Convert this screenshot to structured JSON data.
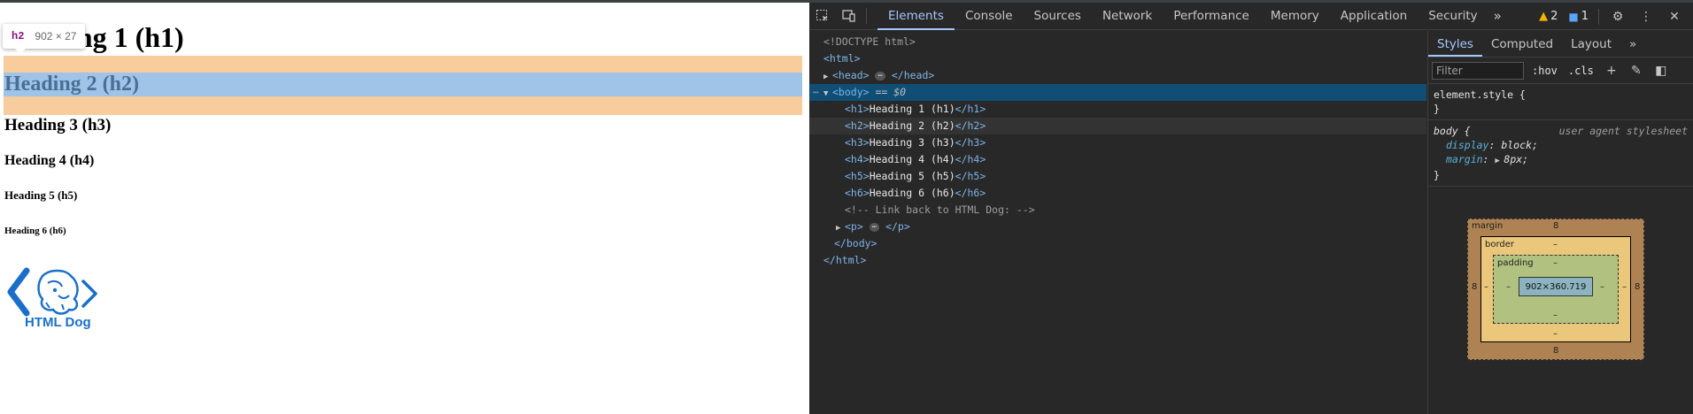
{
  "page": {
    "headings": {
      "h1": "Heading 1 (h1)",
      "h2": "Heading 2 (h2)",
      "h3": "Heading 3 (h3)",
      "h4": "Heading 4 (h4)",
      "h5": "Heading 5 (h5)",
      "h6": "Heading 6 (h6)"
    },
    "tooltip": {
      "tag": "h2",
      "size": "902 × 27"
    },
    "logo_text": "HTML Dog"
  },
  "devtools": {
    "tabs": [
      "Elements",
      "Console",
      "Sources",
      "Network",
      "Performance",
      "Memory",
      "Application",
      "Security"
    ],
    "active_tab": "Elements",
    "warnings_count": "2",
    "messages_count": "1",
    "dom_lines": {
      "doctype": "<!DOCTYPE html>",
      "html_open": "<html>",
      "head_open": "<head>",
      "head_close": "</head>",
      "body_open": "<body>",
      "body_eq": "== $0",
      "h1_open": "<h1>",
      "h1_text": "Heading 1 (h1)",
      "h1_close": "</h1>",
      "h2_open": "<h2>",
      "h2_text": "Heading 2 (h2)",
      "h2_close": "</h2>",
      "h3_open": "<h3>",
      "h3_text": "Heading 3 (h3)",
      "h3_close": "</h3>",
      "h4_open": "<h4>",
      "h4_text": "Heading 4 (h4)",
      "h4_close": "</h4>",
      "h5_open": "<h5>",
      "h5_text": "Heading 5 (h5)",
      "h5_close": "</h5>",
      "h6_open": "<h6>",
      "h6_text": "Heading 6 (h6)",
      "h6_close": "</h6>",
      "comment": "<!-- Link back to HTML Dog: -->",
      "p_open": "<p>",
      "p_close": "</p>",
      "body_close": "</body>",
      "html_close": "</html>"
    },
    "styles": {
      "tabs": [
        "Styles",
        "Computed",
        "Layout"
      ],
      "active_tab": "Styles",
      "filter_placeholder": "Filter",
      "hov": ":hov",
      "cls": ".cls",
      "element_style_selector": "element.style {",
      "element_style_close": "}",
      "body_rule": {
        "selector": "body {",
        "source": "user agent stylesheet",
        "props": [
          {
            "name": "display",
            "value": "block;"
          },
          {
            "name": "margin",
            "value": "8px;"
          }
        ],
        "close": "}"
      },
      "box_model": {
        "margin_label": "margin",
        "border_label": "border",
        "padding_label": "padding",
        "margin_top": "8",
        "margin_bottom": "8",
        "margin_left": "8",
        "margin_right": "8",
        "border_top": "–",
        "border_bottom": "–",
        "border_left": "–",
        "border_right": "–",
        "padding_top": "–",
        "padding_bottom": "–",
        "padding_left": "–",
        "padding_right": "–",
        "content": "902×360.719"
      }
    }
  },
  "colors": {
    "margin_highlight": "#f9cc9d",
    "content_highlight": "#9fc4e7",
    "devtools_bg": "#282828",
    "selected_row": "#104e75",
    "accent": "#a8c7fa"
  }
}
